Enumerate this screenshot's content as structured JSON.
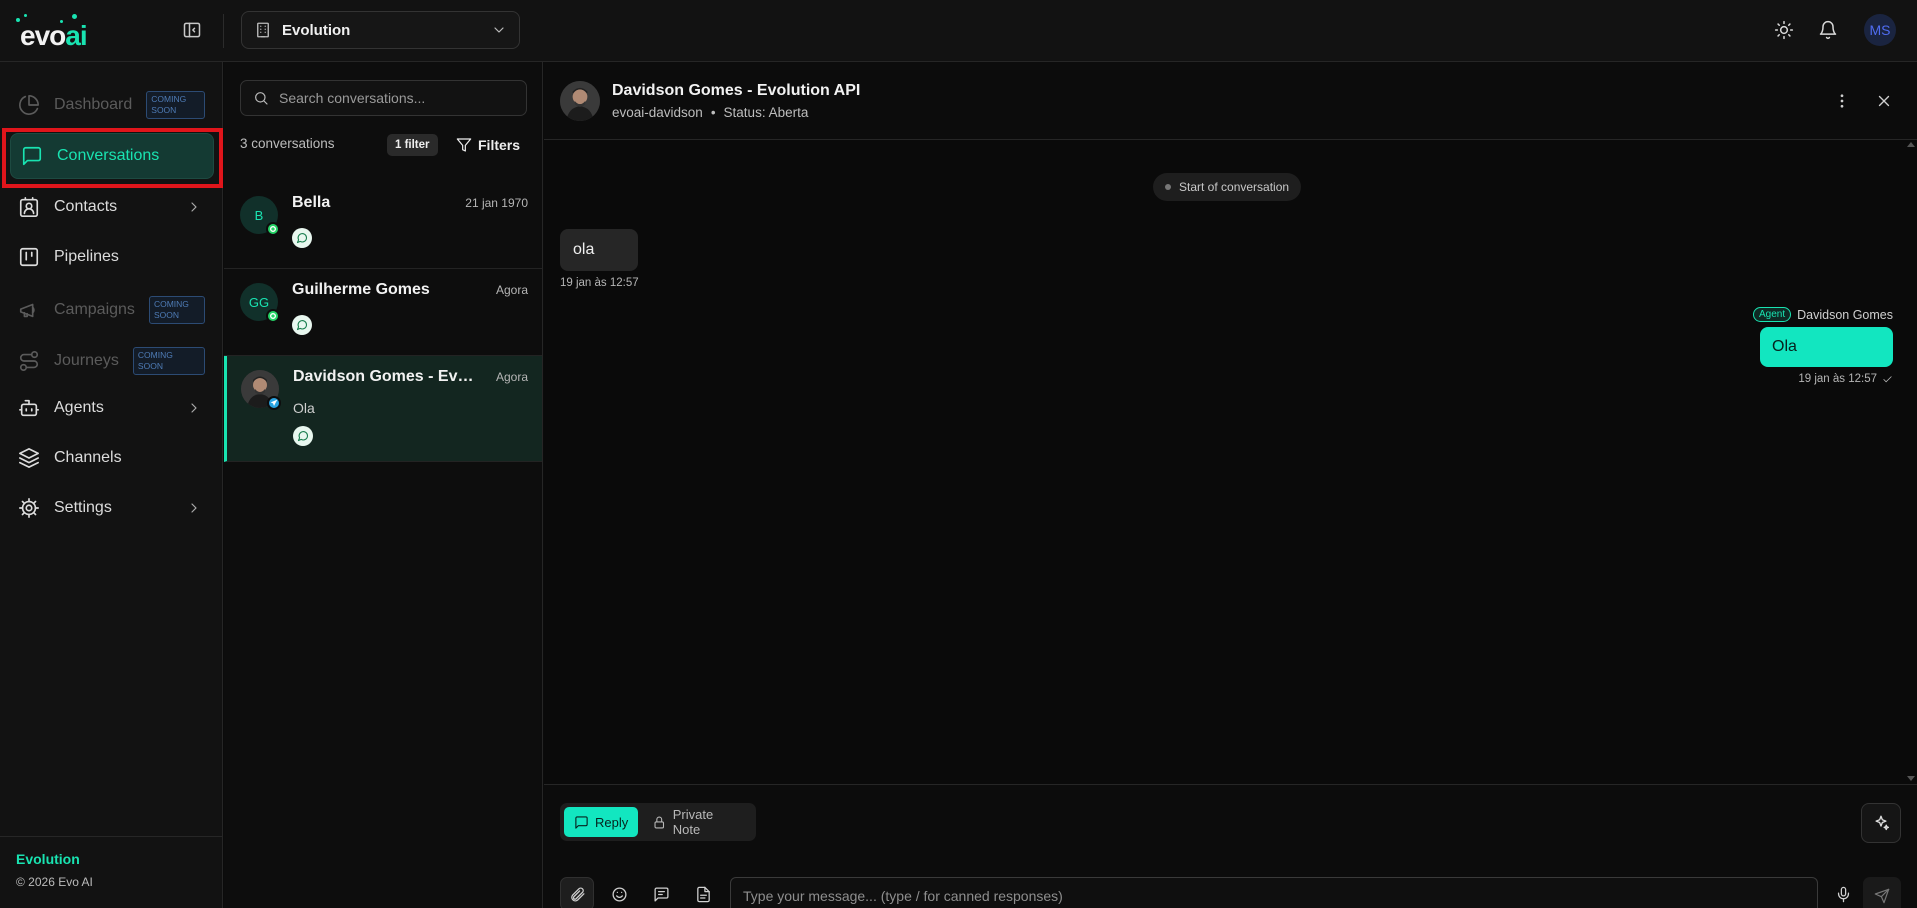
{
  "app": {
    "logo_text_main": "evo",
    "logo_text_accent": "ai",
    "accent_color": "#19e3b1"
  },
  "topbar": {
    "workspace_name": "Evolution",
    "user_initials": "MS",
    "icons": [
      "sidebar-toggle-icon",
      "building-icon",
      "chevron-down-icon",
      "sun-icon",
      "bell-icon"
    ]
  },
  "sidebar": {
    "items": [
      {
        "label": "Dashboard",
        "badge": "COMING SOON",
        "icon": "pie-chart-icon",
        "disabled": true
      },
      {
        "label": "Conversations",
        "icon": "message-square-icon",
        "active": true
      },
      {
        "label": "Contacts",
        "icon": "contact-icon",
        "has_children": true
      },
      {
        "label": "Pipelines",
        "icon": "kanban-icon"
      },
      {
        "label": "Campaigns",
        "badge": "COMING SOON",
        "icon": "megaphone-icon",
        "disabled": true
      },
      {
        "label": "Journeys",
        "badge": "COMING SOON",
        "icon": "route-icon",
        "disabled": true
      },
      {
        "label": "Agents",
        "icon": "bot-icon",
        "has_children": true
      },
      {
        "label": "Channels",
        "icon": "layers-icon"
      },
      {
        "label": "Settings",
        "icon": "gear-icon",
        "has_children": true
      }
    ],
    "footer_org": "Evolution",
    "footer_copyright": "© 2026 Evo AI"
  },
  "conversation_list": {
    "search_placeholder": "Search conversations...",
    "count_label": "3 conversations",
    "filter_count_label": "1 filter",
    "filters_label": "Filters",
    "items": [
      {
        "initials": "B",
        "name": "Bella",
        "time": "21 jan 1970",
        "preview": "",
        "channel": "whatsapp"
      },
      {
        "initials": "GG",
        "name": "Guilherme Gomes",
        "time": "Agora",
        "preview": "",
        "channel": "whatsapp"
      },
      {
        "initials": "",
        "name": "Davidson Gomes - Evolution API",
        "time": "Agora",
        "preview": "Ola",
        "channel": "telegram",
        "selected": true
      }
    ]
  },
  "chat": {
    "title": "Davidson Gomes - Evolution API",
    "inbox": "evoai-davidson",
    "separator": "•",
    "status": "Status: Aberta",
    "start_label": "Start of conversation",
    "messages": [
      {
        "direction": "in",
        "text": "ola",
        "time": "19 jan às 12:57"
      },
      {
        "direction": "out",
        "text": "Ola",
        "time": "19 jan às 12:57",
        "sender": "Davidson Gomes",
        "sender_badge": "Agent"
      }
    ],
    "composer": {
      "reply_label": "Reply",
      "private_note_label": "Private Note",
      "placeholder": "Type your message... (type / for canned responses)"
    }
  }
}
